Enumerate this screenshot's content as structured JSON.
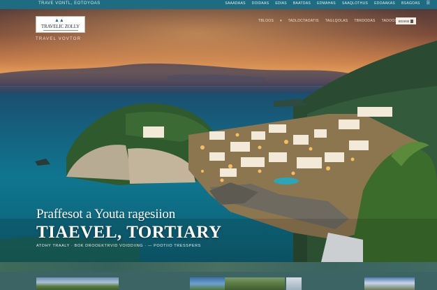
{
  "topbar": {
    "tagline": "TRAVE VONTL, EOTOYOAS",
    "nav": [
      "SAAADAAS",
      "DOIDAAS",
      "EDIAS",
      "BAATOAS",
      "EDMAHAS",
      "SAAQLOTHUS",
      "EDOAAKAS",
      "BSAGOAS"
    ],
    "icons": [
      "menu-icon"
    ]
  },
  "header": {
    "logo_name": "TRAVELIC ZOLLY",
    "tagline": "TRAVEL VOVTOR",
    "nav": [
      "TBLOOS",
      "TADLDCTAOATIS",
      "TAGLQOLAS",
      "TBRDODAS",
      "TADOOS"
    ],
    "book_label": "BGSKB"
  },
  "hero": {
    "headline": "Praffesot a Youta ragesiion",
    "title": "TIAEVEL, TORTIARY",
    "subline": "ATOHY TRAALY · BOK DROOEKTRVID VOIDDIING · — POOTIIO TRESSPERS"
  },
  "colors": {
    "topbar": "#1f6c82",
    "sky_glow": "#e29a58",
    "sea": "#0f6c86",
    "accent_white": "#ffffff"
  }
}
